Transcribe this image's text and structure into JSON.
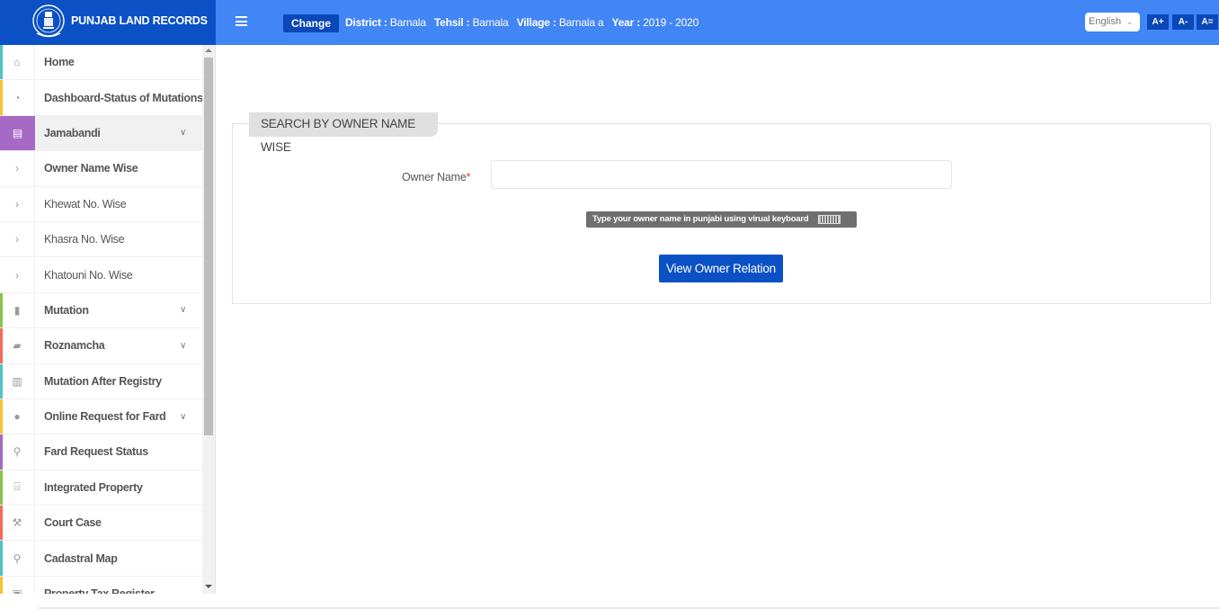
{
  "app": {
    "title": "PUNJAB LAND RECORDS",
    "brand_color": "#0b51c5",
    "topbar_color": "#4285f4"
  },
  "header": {
    "menu_icon": "hamburger-icon",
    "change_label": "Change",
    "context": {
      "district_label": "District :",
      "district_value": "Barnala",
      "tehsil_label": "Tehsil :",
      "tehsil_value": "Barnala",
      "village_label": "Village :",
      "village_value": "Barnala a",
      "year_label": "Year :",
      "year_value": "2019 - 2020"
    },
    "language": "English",
    "font_buttons": [
      "A+",
      "A-",
      "A="
    ]
  },
  "sidebar": {
    "items": [
      {
        "label": "Home",
        "icon": "home-icon",
        "glyph": "⌂",
        "color": "#4fc3c7",
        "dropdown": false
      },
      {
        "label": "Dashboard-Status of Mutations",
        "icon": "dashboard-icon",
        "glyph": "◔",
        "color": "#fbc02d",
        "dropdown": false
      },
      {
        "label": "Jamabandi",
        "icon": "newspaper-icon",
        "glyph": "▤",
        "color": "#a66ac6",
        "dropdown": true,
        "open": true
      },
      {
        "label": "Owner Name Wise",
        "icon": "chevron-right-icon",
        "glyph": "›",
        "sub": true,
        "active": true
      },
      {
        "label": "Khewat No. Wise",
        "icon": "chevron-right-icon",
        "glyph": "›",
        "sub": true
      },
      {
        "label": "Khasra No. Wise",
        "icon": "chevron-right-icon",
        "glyph": "›",
        "sub": true
      },
      {
        "label": "Khatouni No. Wise",
        "icon": "chevron-right-icon",
        "glyph": "›",
        "sub": true
      },
      {
        "label": "Mutation",
        "icon": "file-icon",
        "glyph": "▮",
        "color": "#8bc34a",
        "dropdown": true
      },
      {
        "label": "Roznamcha",
        "icon": "book-icon",
        "glyph": "▰",
        "color": "#f26b5b",
        "dropdown": true
      },
      {
        "label": "Mutation After Registry",
        "icon": "briefcase-icon",
        "glyph": "▥",
        "color": "#4fc3c7",
        "dropdown": false
      },
      {
        "label": "Online Request for Fard",
        "icon": "drop-icon",
        "glyph": "●",
        "color": "#fbc02d",
        "dropdown": true
      },
      {
        "label": "Fard Request Status",
        "icon": "search-icon",
        "glyph": "⚲",
        "color": "#a66ac6",
        "dropdown": false
      },
      {
        "label": "Integrated Property",
        "icon": "bank-icon",
        "glyph": "⌸",
        "color": "#8bc34a",
        "dropdown": false
      },
      {
        "label": "Court Case",
        "icon": "gavel-icon",
        "glyph": "⚒",
        "color": "#f26b5b",
        "dropdown": false
      },
      {
        "label": "Cadastral Map",
        "icon": "map-marker-icon",
        "glyph": "⚲",
        "color": "#4fc3c7",
        "dropdown": false
      },
      {
        "label": "Property Tax Register",
        "icon": "register-icon",
        "glyph": "▣",
        "color": "#fbc02d",
        "dropdown": false
      }
    ]
  },
  "main": {
    "section_title": "SEARCH BY OWNER NAME WISE",
    "owner_label": "Owner Name",
    "required_mark": "*",
    "owner_value": "",
    "owner_placeholder": "",
    "keyboard_hint": "Type your owner name in punjabi using virual keyboard",
    "submit_label": "View Owner Relation"
  }
}
